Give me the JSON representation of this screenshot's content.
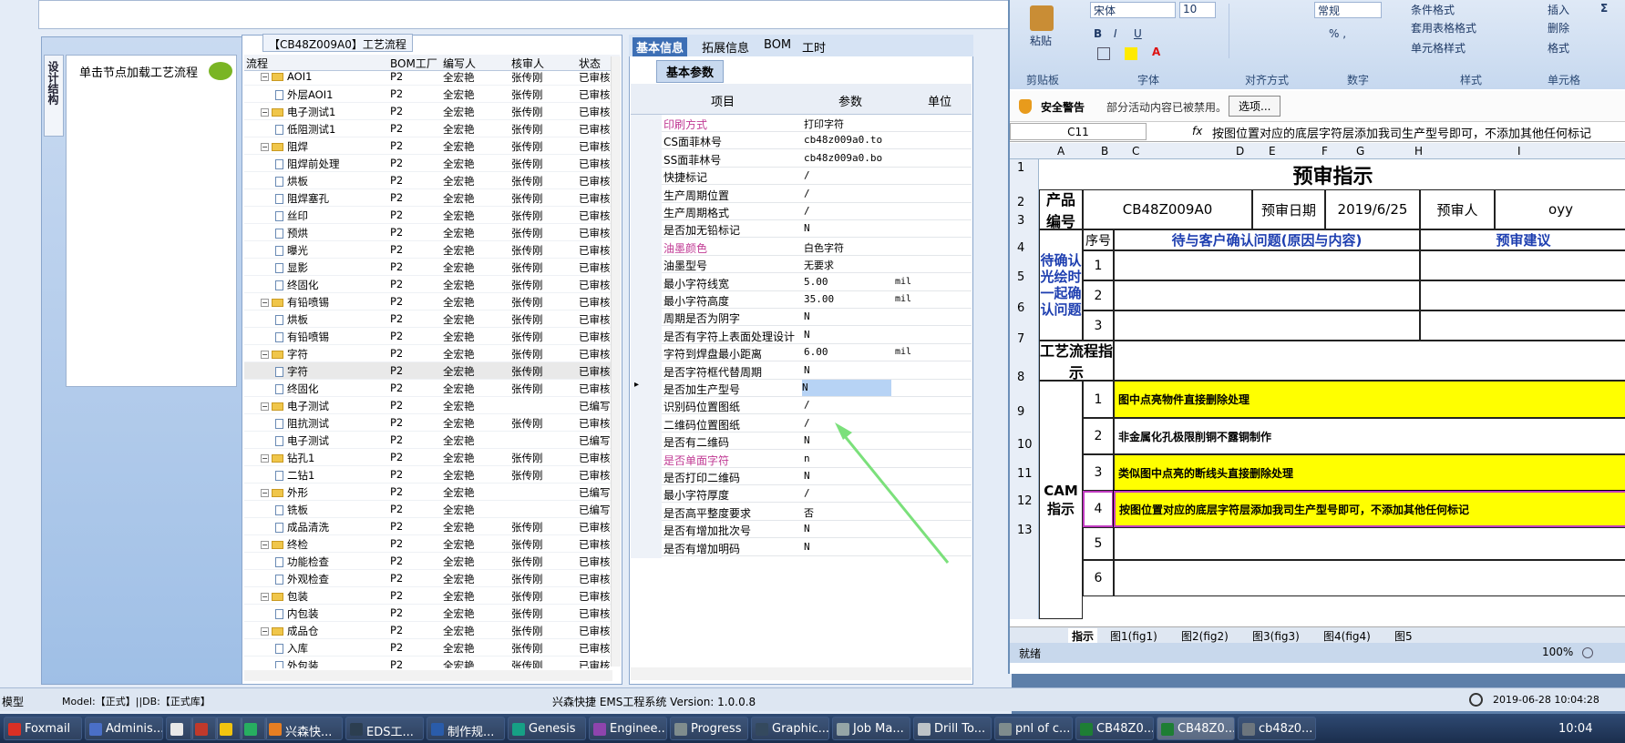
{
  "status": {
    "left_text": "模型",
    "model": "Model:【正式】||DB:【正式库】",
    "app": "兴森快捷  EMS工程系统  Version: 1.0.0.8",
    "datetime": "2019-06-28 10:04:28"
  },
  "left": {
    "vtab": "设计结构",
    "load_label": "单击节点加载工艺流程",
    "tree_title": "【CB48Z009A0】工艺流程"
  },
  "tree": {
    "headers": [
      "流程",
      "BOM工厂",
      "编写人",
      "核审人",
      "状态"
    ],
    "rows": [
      {
        "name": "AOI1",
        "kind": "folder",
        "f": "P2",
        "w": "全宏艳",
        "c": "张传刚",
        "s": "已审核"
      },
      {
        "name": "外层AOI1",
        "kind": "doc",
        "f": "P2",
        "w": "全宏艳",
        "c": "张传刚",
        "s": "已审核"
      },
      {
        "name": "电子测试1",
        "kind": "folder",
        "f": "P2",
        "w": "全宏艳",
        "c": "张传刚",
        "s": "已审核"
      },
      {
        "name": "低阻测试1",
        "kind": "doc",
        "f": "P2",
        "w": "全宏艳",
        "c": "张传刚",
        "s": "已审核"
      },
      {
        "name": "阻焊",
        "kind": "folder",
        "f": "P2",
        "w": "全宏艳",
        "c": "张传刚",
        "s": "已审核"
      },
      {
        "name": "阻焊前处理",
        "kind": "doc",
        "f": "P2",
        "w": "全宏艳",
        "c": "张传刚",
        "s": "已审核"
      },
      {
        "name": "烘板",
        "kind": "doc",
        "f": "P2",
        "w": "全宏艳",
        "c": "张传刚",
        "s": "已审核"
      },
      {
        "name": "阻焊塞孔",
        "kind": "doc",
        "f": "P2",
        "w": "全宏艳",
        "c": "张传刚",
        "s": "已审核"
      },
      {
        "name": "丝印",
        "kind": "doc",
        "f": "P2",
        "w": "全宏艳",
        "c": "张传刚",
        "s": "已审核"
      },
      {
        "name": "预烘",
        "kind": "doc",
        "f": "P2",
        "w": "全宏艳",
        "c": "张传刚",
        "s": "已审核"
      },
      {
        "name": "曝光",
        "kind": "doc",
        "f": "P2",
        "w": "全宏艳",
        "c": "张传刚",
        "s": "已审核"
      },
      {
        "name": "显影",
        "kind": "doc",
        "f": "P2",
        "w": "全宏艳",
        "c": "张传刚",
        "s": "已审核"
      },
      {
        "name": "终固化",
        "kind": "doc",
        "f": "P2",
        "w": "全宏艳",
        "c": "张传刚",
        "s": "已审核"
      },
      {
        "name": "有铅喷锡",
        "kind": "folder",
        "f": "P2",
        "w": "全宏艳",
        "c": "张传刚",
        "s": "已审核"
      },
      {
        "name": "烘板",
        "kind": "doc",
        "f": "P2",
        "w": "全宏艳",
        "c": "张传刚",
        "s": "已审核"
      },
      {
        "name": "有铅喷锡",
        "kind": "doc",
        "f": "P2",
        "w": "全宏艳",
        "c": "张传刚",
        "s": "已审核"
      },
      {
        "name": "字符",
        "kind": "folder",
        "f": "P2",
        "w": "全宏艳",
        "c": "张传刚",
        "s": "已审核"
      },
      {
        "name": "字符",
        "kind": "doc",
        "f": "P2",
        "w": "全宏艳",
        "c": "张传刚",
        "s": "已审核"
      },
      {
        "name": "终固化",
        "kind": "doc",
        "f": "P2",
        "w": "全宏艳",
        "c": "张传刚",
        "s": "已审核"
      },
      {
        "name": "电子测试",
        "kind": "folder",
        "f": "P2",
        "w": "全宏艳",
        "c": "",
        "s": "已编写"
      },
      {
        "name": "阻抗测试",
        "kind": "doc",
        "f": "P2",
        "w": "全宏艳",
        "c": "张传刚",
        "s": "已审核"
      },
      {
        "name": "电子测试",
        "kind": "doc",
        "f": "P2",
        "w": "全宏艳",
        "c": "",
        "s": "已编写"
      },
      {
        "name": "钻孔1",
        "kind": "folder",
        "f": "P2",
        "w": "全宏艳",
        "c": "张传刚",
        "s": "已审核"
      },
      {
        "name": "二钻1",
        "kind": "doc",
        "f": "P2",
        "w": "全宏艳",
        "c": "张传刚",
        "s": "已审核"
      },
      {
        "name": "外形",
        "kind": "folder",
        "f": "P2",
        "w": "全宏艳",
        "c": "",
        "s": "已编写"
      },
      {
        "name": "铣板",
        "kind": "doc",
        "f": "P2",
        "w": "全宏艳",
        "c": "",
        "s": "已编写"
      },
      {
        "name": "成品清洗",
        "kind": "doc",
        "f": "P2",
        "w": "全宏艳",
        "c": "张传刚",
        "s": "已审核"
      },
      {
        "name": "终检",
        "kind": "folder",
        "f": "P2",
        "w": "全宏艳",
        "c": "张传刚",
        "s": "已审核"
      },
      {
        "name": "功能检查",
        "kind": "doc",
        "f": "P2",
        "w": "全宏艳",
        "c": "张传刚",
        "s": "已审核"
      },
      {
        "name": "外观检查",
        "kind": "doc",
        "f": "P2",
        "w": "全宏艳",
        "c": "张传刚",
        "s": "已审核"
      },
      {
        "name": "包装",
        "kind": "folder",
        "f": "P2",
        "w": "全宏艳",
        "c": "张传刚",
        "s": "已审核"
      },
      {
        "name": "内包装",
        "kind": "doc",
        "f": "P2",
        "w": "全宏艳",
        "c": "张传刚",
        "s": "已审核"
      },
      {
        "name": "成品仓",
        "kind": "folder",
        "f": "P2",
        "w": "全宏艳",
        "c": "张传刚",
        "s": "已审核"
      },
      {
        "name": "入库",
        "kind": "doc",
        "f": "P2",
        "w": "全宏艳",
        "c": "张传刚",
        "s": "已审核"
      },
      {
        "name": "外包装",
        "kind": "doc",
        "f": "P2",
        "w": "全宏艳",
        "c": "张传刚",
        "s": "已审核"
      }
    ]
  },
  "params": {
    "tabs": [
      "基本信息",
      "拓展信息",
      "BOM",
      "工时"
    ],
    "group": "基本参数",
    "headers": [
      "项目",
      "参数",
      "单位"
    ],
    "rows": [
      {
        "item": "印刷方式",
        "val": "打印字符",
        "unit": "",
        "pink": true
      },
      {
        "item": "CS面菲林号",
        "val": "cb48z009a0.to",
        "unit": "",
        "pink": false
      },
      {
        "item": "SS面菲林号",
        "val": "cb48z009a0.bo",
        "unit": "",
        "pink": false
      },
      {
        "item": "快捷标记",
        "val": "/",
        "unit": "",
        "pink": false
      },
      {
        "item": "生产周期位置",
        "val": "/",
        "unit": "",
        "pink": false
      },
      {
        "item": "生产周期格式",
        "val": "/",
        "unit": "",
        "pink": false
      },
      {
        "item": "是否加无铅标记",
        "val": "N",
        "unit": "",
        "pink": false
      },
      {
        "item": "油墨颜色",
        "val": "白色字符",
        "unit": "",
        "pink": true
      },
      {
        "item": "油墨型号",
        "val": "无要求",
        "unit": "",
        "pink": false
      },
      {
        "item": "最小字符线宽",
        "val": "5.00",
        "unit": "mil",
        "pink": false
      },
      {
        "item": "最小字符高度",
        "val": "35.00",
        "unit": "mil",
        "pink": false
      },
      {
        "item": "周期是否为阴字",
        "val": "N",
        "unit": "",
        "pink": false
      },
      {
        "item": "是否有字符上表面处理设计",
        "val": "N",
        "unit": "",
        "pink": false
      },
      {
        "item": "字符到焊盘最小距离",
        "val": "6.00",
        "unit": "mil",
        "pink": false
      },
      {
        "item": "是否字符框代替周期",
        "val": "N",
        "unit": "",
        "pink": false
      },
      {
        "item": "是否加生产型号",
        "val": "N",
        "unit": "",
        "pink": false,
        "selected": true
      },
      {
        "item": "识别码位置图纸",
        "val": "/",
        "unit": "",
        "pink": false
      },
      {
        "item": "二维码位置图纸",
        "val": "/",
        "unit": "",
        "pink": false
      },
      {
        "item": "是否有二维码",
        "val": "N",
        "unit": "",
        "pink": false
      },
      {
        "item": "是否单面字符",
        "val": "n",
        "unit": "",
        "pink": true
      },
      {
        "item": "是否打印二维码",
        "val": "N",
        "unit": "",
        "pink": false
      },
      {
        "item": "最小字符厚度",
        "val": "/",
        "unit": "",
        "pink": false
      },
      {
        "item": "是否高平整度要求",
        "val": "否",
        "unit": "",
        "pink": false
      },
      {
        "item": "是否有增加批次号",
        "val": "N",
        "unit": "",
        "pink": false
      },
      {
        "item": "是否有增加明码",
        "val": "N",
        "unit": "",
        "pink": false
      }
    ]
  },
  "excel": {
    "ribbon": {
      "paste": "粘贴",
      "font": "宋体",
      "size": "10",
      "bold": "B",
      "italic": "I",
      "underline": "U",
      "numfmt": "常规",
      "cond": "条件格式",
      "table": "套用表格格式",
      "cellstyle": "单元格样式",
      "insert": "插入",
      "delete": "删除",
      "format": "格式",
      "groups": [
        "剪贴板",
        "字体",
        "对齐方式",
        "数字",
        "样式",
        "单元格"
      ]
    },
    "security": {
      "label": "安全警告",
      "text": "部分活动内容已被禁用。",
      "btn": "选项..."
    },
    "namebox": "C11",
    "fx": "fx",
    "formula": "按图位置对应的底层字符层添加我司生产型号即可，不添加其他任何标记",
    "cols": [
      "A",
      "B",
      "C",
      "D",
      "E",
      "F",
      "G",
      "H",
      "I"
    ],
    "rows": [
      "1",
      "2",
      "3",
      "4",
      "5",
      "6",
      "7",
      "8",
      "9",
      "10",
      "11",
      "12",
      "13"
    ],
    "title": "预审指示",
    "product_label": "产品编号",
    "product": "CB48Z009A0",
    "date_label": "预审日期",
    "date": "2019/6/25",
    "reviewer_label": "预审人",
    "reviewer": "oyy",
    "seq_label": "序号",
    "issue_label": "待与客户确认问题(原因与内容)",
    "suggest_label": "预审建议",
    "confirm_label": "待确认光绘时一起确认问题",
    "process_label": "工艺流程指示",
    "cam_label": "CAM指示",
    "n1": "1",
    "n2": "2",
    "n3": "3",
    "n4": "4",
    "n5": "5",
    "n6": "6",
    "cam1": "图中点亮物件直接删除处理",
    "cam2": "非金属化孔极限削铜不露铜制作",
    "cam3": "类似图中点亮的断线头直接删除处理",
    "cam4": "按图位置对应的底层字符层添加我司生产型号即可，不添加其他任何标记",
    "sheets": [
      "指示",
      "图1(fig1)",
      "图2(fig2)",
      "图3(fig3)",
      "图4(fig4)",
      "图5"
    ],
    "ready": "就绪",
    "zoom": "100%"
  },
  "taskbar": [
    {
      "label": "Foxmail",
      "color": "#d93025"
    },
    {
      "label": "Adminis...",
      "color": "#4a6fc7"
    },
    {
      "label": "",
      "color": "#e8e8e8"
    },
    {
      "label": "",
      "color": "#c0392b"
    },
    {
      "label": "",
      "color": "#f1c40f"
    },
    {
      "label": "",
      "color": "#27ae60"
    },
    {
      "label": "兴森快...",
      "color": "#e67e22"
    },
    {
      "label": "EDS工...",
      "color": "#2c3e50"
    },
    {
      "label": "制作规...",
      "color": "#2a5caa"
    },
    {
      "label": "Genesis",
      "color": "#16a085"
    },
    {
      "label": "Enginee...",
      "color": "#8e44ad"
    },
    {
      "label": "Progress",
      "color": "#7f8c8d"
    },
    {
      "label": "Graphic...",
      "color": "#34495e"
    },
    {
      "label": "Job Ma...",
      "color": "#95a5a6"
    },
    {
      "label": "Drill To...",
      "color": "#bdc3c7"
    },
    {
      "label": "pnl of c...",
      "color": "#7f8c8d"
    },
    {
      "label": "CB48Z0...",
      "color": "#1e7e34"
    },
    {
      "label": "CB48Z0...",
      "color": "#1e7e34"
    },
    {
      "label": "cb48z0...",
      "color": "#6c757d"
    }
  ],
  "clock": "10:04"
}
